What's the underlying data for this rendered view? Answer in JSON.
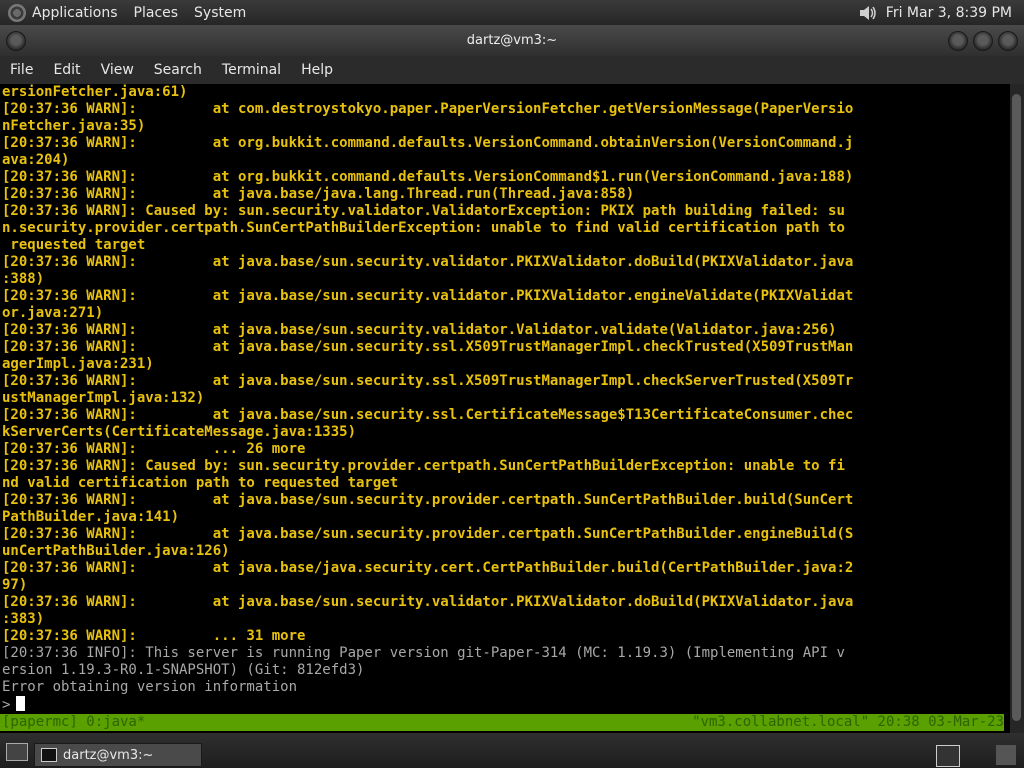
{
  "top_panel": {
    "menus": [
      "Applications",
      "Places",
      "System"
    ],
    "clock": "Fri Mar  3,  8:39 PM"
  },
  "window": {
    "title": "dartz@vm3:~"
  },
  "menubar": [
    "File",
    "Edit",
    "View",
    "Search",
    "Terminal",
    "Help"
  ],
  "terminal": {
    "lines": [
      {
        "text": "ersionFetcher.java:61)",
        "type": "warn"
      },
      {
        "text": "[20:37:36 WARN]:         at com.destroystokyo.paper.PaperVersionFetcher.getVersionMessage(PaperVersio",
        "type": "warn"
      },
      {
        "text": "nFetcher.java:35)",
        "type": "warn"
      },
      {
        "text": "[20:37:36 WARN]:         at org.bukkit.command.defaults.VersionCommand.obtainVersion(VersionCommand.j",
        "type": "warn"
      },
      {
        "text": "ava:204)",
        "type": "warn"
      },
      {
        "text": "[20:37:36 WARN]:         at org.bukkit.command.defaults.VersionCommand$1.run(VersionCommand.java:188)",
        "type": "warn"
      },
      {
        "text": "[20:37:36 WARN]:         at java.base/java.lang.Thread.run(Thread.java:858)",
        "type": "warn"
      },
      {
        "text": "[20:37:36 WARN]: Caused by: sun.security.validator.ValidatorException: PKIX path building failed: su",
        "type": "warn"
      },
      {
        "text": "n.security.provider.certpath.SunCertPathBuilderException: unable to find valid certification path to",
        "type": "warn"
      },
      {
        "text": " requested target",
        "type": "warn"
      },
      {
        "text": "[20:37:36 WARN]:         at java.base/sun.security.validator.PKIXValidator.doBuild(PKIXValidator.java",
        "type": "warn"
      },
      {
        "text": ":388)",
        "type": "warn"
      },
      {
        "text": "[20:37:36 WARN]:         at java.base/sun.security.validator.PKIXValidator.engineValidate(PKIXValidat",
        "type": "warn"
      },
      {
        "text": "or.java:271)",
        "type": "warn"
      },
      {
        "text": "[20:37:36 WARN]:         at java.base/sun.security.validator.Validator.validate(Validator.java:256)",
        "type": "warn"
      },
      {
        "text": "[20:37:36 WARN]:         at java.base/sun.security.ssl.X509TrustManagerImpl.checkTrusted(X509TrustMan",
        "type": "warn"
      },
      {
        "text": "agerImpl.java:231)",
        "type": "warn"
      },
      {
        "text": "[20:37:36 WARN]:         at java.base/sun.security.ssl.X509TrustManagerImpl.checkServerTrusted(X509Tr",
        "type": "warn"
      },
      {
        "text": "ustManagerImpl.java:132)",
        "type": "warn"
      },
      {
        "text": "[20:37:36 WARN]:         at java.base/sun.security.ssl.CertificateMessage$T13CertificateConsumer.chec",
        "type": "warn"
      },
      {
        "text": "kServerCerts(CertificateMessage.java:1335)",
        "type": "warn"
      },
      {
        "text": "[20:37:36 WARN]:         ... 26 more",
        "type": "warn"
      },
      {
        "text": "[20:37:36 WARN]: Caused by: sun.security.provider.certpath.SunCertPathBuilderException: unable to fi",
        "type": "warn"
      },
      {
        "text": "nd valid certification path to requested target",
        "type": "warn"
      },
      {
        "text": "[20:37:36 WARN]:         at java.base/sun.security.provider.certpath.SunCertPathBuilder.build(SunCert",
        "type": "warn"
      },
      {
        "text": "PathBuilder.java:141)",
        "type": "warn"
      },
      {
        "text": "[20:37:36 WARN]:         at java.base/sun.security.provider.certpath.SunCertPathBuilder.engineBuild(S",
        "type": "warn"
      },
      {
        "text": "unCertPathBuilder.java:126)",
        "type": "warn"
      },
      {
        "text": "[20:37:36 WARN]:         at java.base/java.security.cert.CertPathBuilder.build(CertPathBuilder.java:2",
        "type": "warn"
      },
      {
        "text": "97)",
        "type": "warn"
      },
      {
        "text": "[20:37:36 WARN]:         at java.base/sun.security.validator.PKIXValidator.doBuild(PKIXValidator.java",
        "type": "warn"
      },
      {
        "text": ":383)",
        "type": "warn"
      },
      {
        "text": "[20:37:36 WARN]:         ... 31 more",
        "type": "warn"
      },
      {
        "text": "[20:37:36 INFO]: This server is running Paper version git-Paper-314 (MC: 1.19.3) (Implementing API v",
        "type": "info"
      },
      {
        "text": "ersion 1.19.3-R0.1-SNAPSHOT) (Git: 812efd3)",
        "type": "info"
      },
      {
        "text": "Error obtaining version information",
        "type": "info"
      }
    ],
    "prompt": ">"
  },
  "statusbar": {
    "left": "[papermc] 0:java*",
    "right": "\"vm3.collabnet.local\" 20:38 03-Mar-23"
  },
  "taskbar": {
    "window_button": "dartz@vm3:~"
  },
  "colors": {
    "warn_text": "#e8c10e",
    "info_text": "#a8a8a8",
    "status_bg": "#5aa000",
    "status_fg": "#2f6400"
  }
}
